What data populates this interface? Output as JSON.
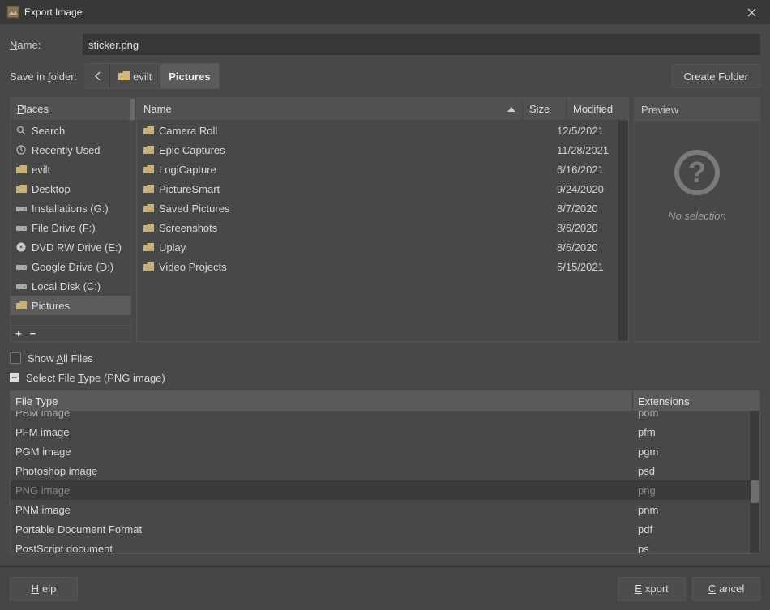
{
  "window": {
    "title": "Export Image"
  },
  "name_label_pre": "N",
  "name_label_post": "ame:",
  "name_value": "sticker.png",
  "save_in_label_pre": "Save in ",
  "save_in_label_u": "f",
  "save_in_label_post": "older:",
  "path": {
    "seg1": "evilt",
    "seg2": "Pictures"
  },
  "create_folder": "Create Folder",
  "places_header_u": "P",
  "places_header_rest": "laces",
  "places": [
    {
      "icon": "search",
      "label": "Search"
    },
    {
      "icon": "recent",
      "label": "Recently Used"
    },
    {
      "icon": "folder",
      "label": "evilt"
    },
    {
      "icon": "folder",
      "label": "Desktop"
    },
    {
      "icon": "drive",
      "label": "Installations (G:)"
    },
    {
      "icon": "drive",
      "label": "File Drive (F:)"
    },
    {
      "icon": "disc",
      "label": "DVD RW Drive (E:)"
    },
    {
      "icon": "drive",
      "label": "Google Drive (D:)"
    },
    {
      "icon": "drive",
      "label": "Local Disk (C:)"
    },
    {
      "icon": "folder",
      "label": "Pictures",
      "selected": true
    }
  ],
  "cols": {
    "name": "Name",
    "size": "Size",
    "modified": "Modified"
  },
  "files": [
    {
      "name": "Camera Roll",
      "size": "",
      "modified": "12/5/2021"
    },
    {
      "name": "Epic Captures",
      "size": "",
      "modified": "11/28/2021"
    },
    {
      "name": "LogiCapture",
      "size": "",
      "modified": "6/16/2021"
    },
    {
      "name": "PictureSmart",
      "size": "",
      "modified": "9/24/2020"
    },
    {
      "name": "Saved Pictures",
      "size": "",
      "modified": "8/7/2020"
    },
    {
      "name": "Screenshots",
      "size": "",
      "modified": "8/6/2020"
    },
    {
      "name": "Uplay",
      "size": "",
      "modified": "8/6/2020"
    },
    {
      "name": "Video Projects",
      "size": "",
      "modified": "5/15/2021"
    }
  ],
  "preview_header": "Preview",
  "preview_noselection": "No selection",
  "show_all_pre": "Show ",
  "show_all_u": "A",
  "show_all_post": "ll Files",
  "select_ft_pre": "Select File ",
  "select_ft_u": "T",
  "select_ft_post": "ype (PNG image)",
  "ft_header": {
    "name": "File Type",
    "ext": "Extensions"
  },
  "filetypes": [
    {
      "name": "PBM image",
      "ext": "pbm",
      "cut": true
    },
    {
      "name": "PFM image",
      "ext": "pfm"
    },
    {
      "name": "PGM image",
      "ext": "pgm"
    },
    {
      "name": "Photoshop image",
      "ext": "psd"
    },
    {
      "name": "PNG image",
      "ext": "png",
      "selected": true
    },
    {
      "name": "PNM image",
      "ext": "pnm"
    },
    {
      "name": "Portable Document Format",
      "ext": "pdf"
    },
    {
      "name": "PostScript document",
      "ext": "ps"
    }
  ],
  "buttons": {
    "help_u": "H",
    "help_rest": "elp",
    "export_u": "E",
    "export_rest": "xport",
    "cancel_u": "C",
    "cancel_rest": "ancel"
  }
}
